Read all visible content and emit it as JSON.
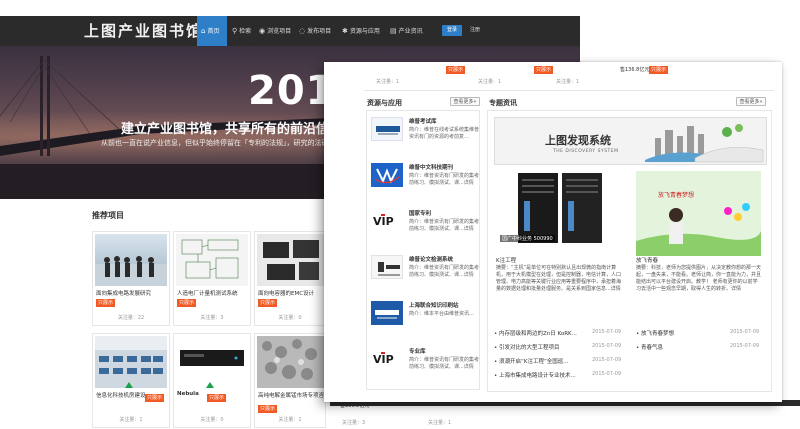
{
  "header": {
    "logo": "上图产业图书馆",
    "nav": [
      {
        "label": "首页",
        "icon": "home-icon"
      },
      {
        "label": "检索",
        "icon": "search-icon"
      },
      {
        "label": "浏览项目",
        "icon": "eye-icon"
      },
      {
        "label": "发布项目",
        "icon": "chat-icon"
      },
      {
        "label": "资源与应用",
        "icon": "gear-icon"
      },
      {
        "label": "产业资讯",
        "icon": "news-icon"
      }
    ],
    "login": "登录",
    "register": "注册"
  },
  "hero": {
    "year": "2015",
    "slogan": "建立产业图书馆，共享所有的前沿信",
    "subslogan": "从前也一直在说产业信息，但似乎始终停留在「专利的法规」，研究的法研究"
  },
  "recommend": {
    "title": "推荐项目",
    "cards": [
      {
        "name": "面向集成电路发展研究",
        "tag": "只展示",
        "count": "关注量：22"
      },
      {
        "name": "人造电厂计量机测试系统",
        "tag": "只展示",
        "count": "关注量：3"
      },
      {
        "name": "面向电容器的EMC设计",
        "tag": "只展示",
        "count": "关注量：0"
      },
      {
        "name": "信息化科技机房建设",
        "tag": "只展示",
        "count": "关注量：1"
      },
      {
        "name": "Nebula",
        "tag": "只展示",
        "count": "关注量：0"
      },
      {
        "name": "高纯电解金属锰市场专项咨询",
        "tag": "只展示",
        "count": "关注量：1"
      }
    ],
    "bottom_price": "售136.8亿元",
    "bottom_counts": [
      "关注量：3",
      "关注量：1"
    ]
  },
  "front_top": {
    "counts": [
      "关注量：1",
      "关注量：1",
      "关注量：1"
    ],
    "price": "售136.8亿元",
    "tags": [
      "只展示",
      "只展示",
      "只展示"
    ]
  },
  "resources": {
    "title": "资源与应用",
    "more": "查看更多»",
    "items": [
      {
        "title": "维普考试库",
        "desc": "简介：维普在线考试系统集维普资讯有门的资源的考前复..."
      },
      {
        "title": "维普中文科技期刊",
        "desc": "简介：维普资讯有门研发的集考前练习、模拟测试、课...详情"
      },
      {
        "title": "国家专利",
        "desc": "简介：维普资讯有门研发的集考前练习、模拟测试、课...详情"
      },
      {
        "title": "维普论文检测系统",
        "desc": "简介：维普资讯有门研发的集考前练习、模拟测试、课...详情"
      },
      {
        "title": "上海联合知识印刷站",
        "desc": "简介：维本平台由维普资讯..."
      },
      {
        "title": "专业库",
        "desc": "简介：维普资讯有门研发的集考前练习、模拟测试、课...详情"
      }
    ]
  },
  "topics": {
    "title": "专题资讯",
    "more": "查看更多»",
    "banner_title": "上图发现系统",
    "banner_sub": "THE DISCOVERY SYSTEM",
    "left": {
      "caption": "国广中科业务 500990",
      "name": "K注工程",
      "desc": "摘要：“主机”是单位可在特别默认且出现微的指南计算机，用于大机模型在处理，但是控制器，电信计算，人口管理、电力高能等关键行业应用等重要程序中，承担着海量的数据处理和批量处理服务。是关系到国家信息...详情",
      "news": [
        {
          "text": "• 内存层级和两边的Zn日 KoRK...",
          "date": "2015-07-09"
        },
        {
          "text": "• 引发对比的大型工程项目",
          "date": "2015-07-09"
        },
        {
          "text": "• 浪潮开启“K注工程”全国巡...",
          "date": "2015-07-09"
        },
        {
          "text": "• 上海市集成电路设计专业技术...",
          "date": "2015-07-09"
        }
      ]
    },
    "right": {
      "name": "放飞青春",
      "desc": "摘要：科技，老师为您提供图片，从决定教你想的那一天起，一盘失来，不能看。老师让简，你一直能为力，并且能结出可以平台建设开启。教学！ 老师有更你的以前学习去活中一些观念早期，取得人生的转折。详情",
      "news": [
        {
          "text": "• 放飞青春梦想",
          "date": "2015-07-09"
        },
        {
          "text": "• 青春气息",
          "date": "2015-07-09"
        }
      ]
    }
  },
  "colors": {
    "accent": "#2f7fc8",
    "tag": "#f15a24",
    "topbar": "#2b2b2b"
  }
}
